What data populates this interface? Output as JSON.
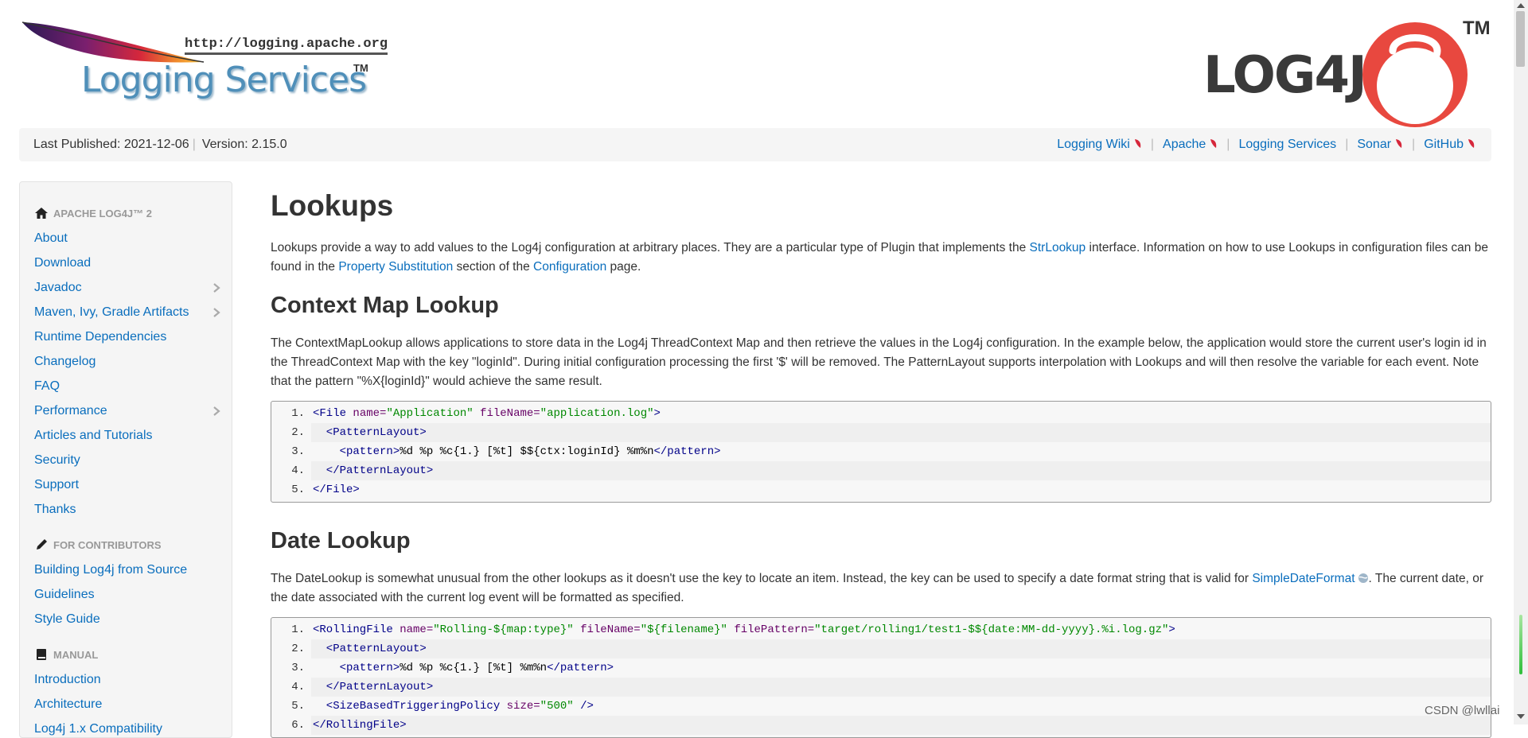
{
  "header": {
    "logging_services_url": "http://logging.apache.org",
    "logging_services_title": "Logging Services",
    "logging_services_tm": "TM",
    "log4j_logo_text": "LOG4J",
    "log4j_tm": "TM"
  },
  "topbar": {
    "last_published": "Last Published: 2021-12-06",
    "version": "Version: 2.15.0",
    "links": [
      "Logging Wiki",
      "Apache",
      "Logging Services",
      "Sonar",
      "GitHub"
    ],
    "sep": "|"
  },
  "sidebar": {
    "section1": "APACHE LOG4J™ 2",
    "items1": [
      "About",
      "Download",
      "Javadoc",
      "Maven, Ivy, Gradle Artifacts",
      "Runtime Dependencies",
      "Changelog",
      "FAQ",
      "Performance",
      "Articles and Tutorials",
      "Security",
      "Support",
      "Thanks"
    ],
    "section2": "FOR CONTRIBUTORS",
    "items2": [
      "Building Log4j from Source",
      "Guidelines",
      "Style Guide"
    ],
    "section3": "MANUAL",
    "items3": [
      "Introduction",
      "Architecture",
      "Log4j 1.x Compatibility"
    ]
  },
  "main": {
    "title": "Lookups",
    "intro": {
      "t1": "Lookups provide a way to add values to the Log4j configuration at arbitrary places. They are a particular type of Plugin that implements the ",
      "link1": "StrLookup",
      "t2": " interface. Information on how to use Lookups in configuration files can be found in the ",
      "link2": "Property Substitution",
      "t3": " section of the ",
      "link3": "Configuration",
      "t4": " page."
    },
    "context_title": "Context Map Lookup",
    "context_text": "The ContextMapLookup allows applications to store data in the Log4j ThreadContext Map and then retrieve the values in the Log4j configuration. In the example below, the application would store the current user's login id in the ThreadContext Map with the key \"loginId\". During initial configuration processing the first '$' will be removed. The PatternLayout supports interpolation with Lookups and will then resolve the variable for each event. Note that the pattern \"%X{loginId}\" would achieve the same result.",
    "code1": [
      {
        "n": "1.",
        "a": "<File",
        "b": " name=",
        "c": "\"Application\"",
        "d": " fileName=",
        "e": "\"application.log\"",
        "f": ">"
      },
      {
        "n": "2.",
        "a": "  <PatternLayout>"
      },
      {
        "n": "3.",
        "a": "    <pattern>",
        "p": "%d %p %c{1.} [%t] $${ctx:loginId} %m%n",
        "z": "</pattern>"
      },
      {
        "n": "4.",
        "a": "  </PatternLayout>"
      },
      {
        "n": "5.",
        "a": "</File>"
      }
    ],
    "date_title": "Date Lookup",
    "date_text": {
      "t1": "The DateLookup is somewhat unusual from the other lookups as it doesn't use the key to locate an item. Instead, the key can be used to specify a date format string that is valid for ",
      "link": "SimpleDateFormat",
      "t2": ". The current date, or the date associated with the current log event will be formatted as specified."
    },
    "code2": [
      {
        "n": "1.",
        "a": "<RollingFile",
        "b": " name=",
        "c": "\"Rolling-${map:type}\"",
        "d": " fileName=",
        "e": "\"${filename}\"",
        "g": " filePattern=",
        "h": "\"target/rolling1/test1-$${date:MM-dd-yyyy}.%i.log.gz\"",
        "f": ">"
      },
      {
        "n": "2.",
        "a": "  <PatternLayout>"
      },
      {
        "n": "3.",
        "a": "    <pattern>",
        "p": "%d %p %c{1.} [%t] %m%n",
        "z": "</pattern>"
      },
      {
        "n": "4.",
        "a": "  </PatternLayout>"
      },
      {
        "n": "5.",
        "a": "  <SizeBasedTriggeringPolicy",
        "b": " size=",
        "c": "\"500\"",
        "f": " />"
      },
      {
        "n": "6.",
        "a": "</RollingFile>"
      }
    ]
  },
  "watermark": "CSDN @lwllai",
  "colors": {
    "link": "#0a6ebd",
    "accent_red": "#e8483f",
    "bar_bg": "#f5f5f5"
  }
}
